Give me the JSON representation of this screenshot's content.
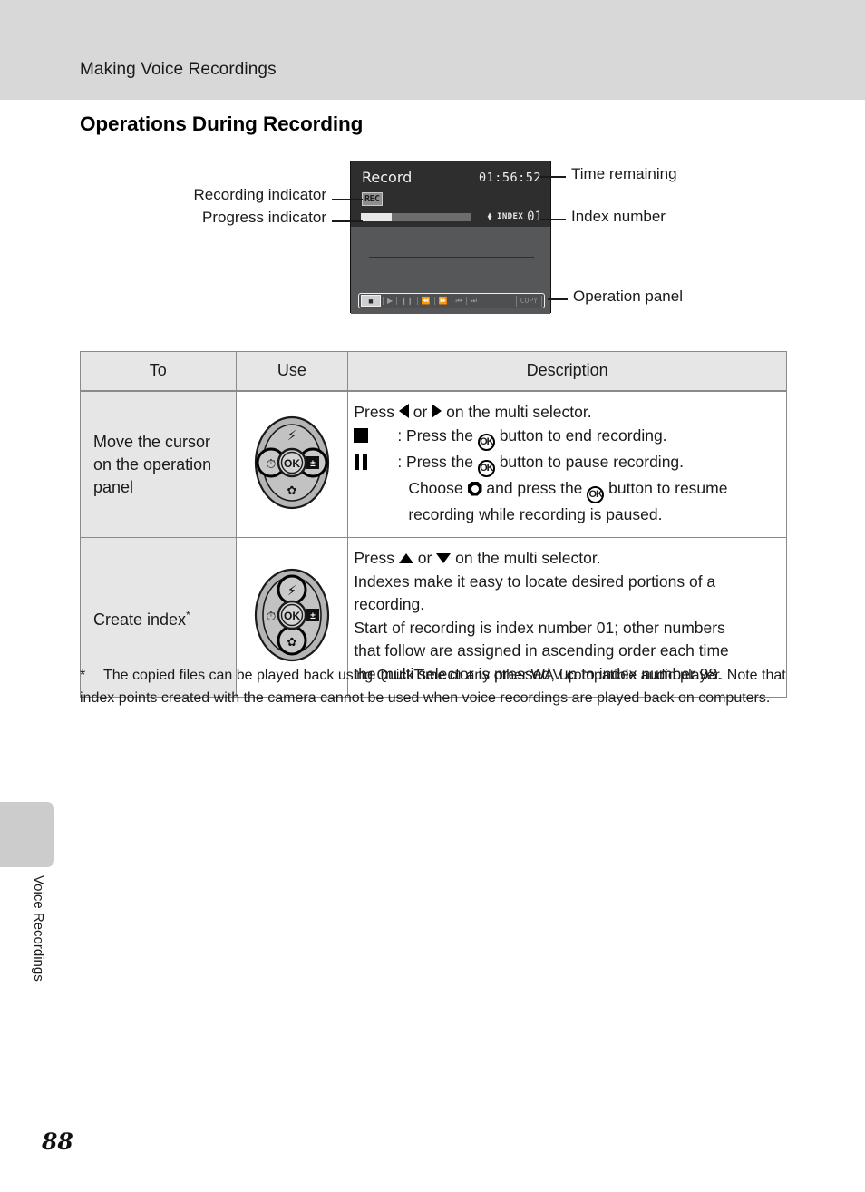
{
  "header": {
    "running_head": "Making Voice Recordings"
  },
  "section": {
    "heading": "Operations During Recording"
  },
  "figure": {
    "lcd": {
      "mode_label": "Record",
      "time_remaining": "01:56:52",
      "rec_badge": "REC",
      "index_label": "INDEX",
      "index_value": "01",
      "copy_button": "COPY"
    },
    "callouts": {
      "recording_indicator": "Recording indicator",
      "progress_indicator": "Progress indicator",
      "time_remaining": "Time remaining",
      "index_number": "Index number",
      "operation_panel": "Operation panel"
    }
  },
  "table": {
    "headers": [
      "To",
      "Use",
      "Description"
    ],
    "rows": [
      {
        "to": "Move the cursor on the operation panel",
        "use_icon": "multi-selector-left-right",
        "description_lines": [
          {
            "prefix": "",
            "text_a": "Press ",
            "glyph1": "left-triangle",
            "text_b": " or ",
            "glyph2": "right-triangle",
            "text_c": " on the multi selector."
          },
          {
            "prefix": "stop-square",
            "text": ": Press the OK button to end recording."
          },
          {
            "prefix": "pause-bars",
            "text": ": Press the OK button to pause recording."
          },
          {
            "prefix": "",
            "text": "Choose ◉ and press the OK button to resume"
          },
          {
            "prefix": "",
            "text": "recording while recording is paused."
          }
        ]
      },
      {
        "to": "Create index",
        "to_superscript": "*",
        "use_icon": "multi-selector-up-down",
        "description_lines": [
          "Press ▲ or ▼ on the multi selector.",
          "Indexes make it easy to locate desired portions of a",
          "recording.",
          "Start of recording is index number 01; other numbers",
          "that follow are assigned in ascending order each time",
          "the multi selector is pressed, up to index number 98."
        ]
      }
    ]
  },
  "footnote": {
    "marker": "*",
    "text": "The copied files can be played back using QuickTime or any other WAV compatible audio player. Note that index points created with the camera cannot be used when voice recordings are played back on computers."
  },
  "sidebar": {
    "chapter_label": "Voice Recordings"
  },
  "footer": {
    "page_number": "88"
  },
  "colors": {
    "header_band": "#d8d8d8",
    "table_header_bg": "#e6e6e6",
    "lcd_top": "#2e2e2e",
    "lcd_bottom": "#555759",
    "side_tab": "#cccccc"
  }
}
